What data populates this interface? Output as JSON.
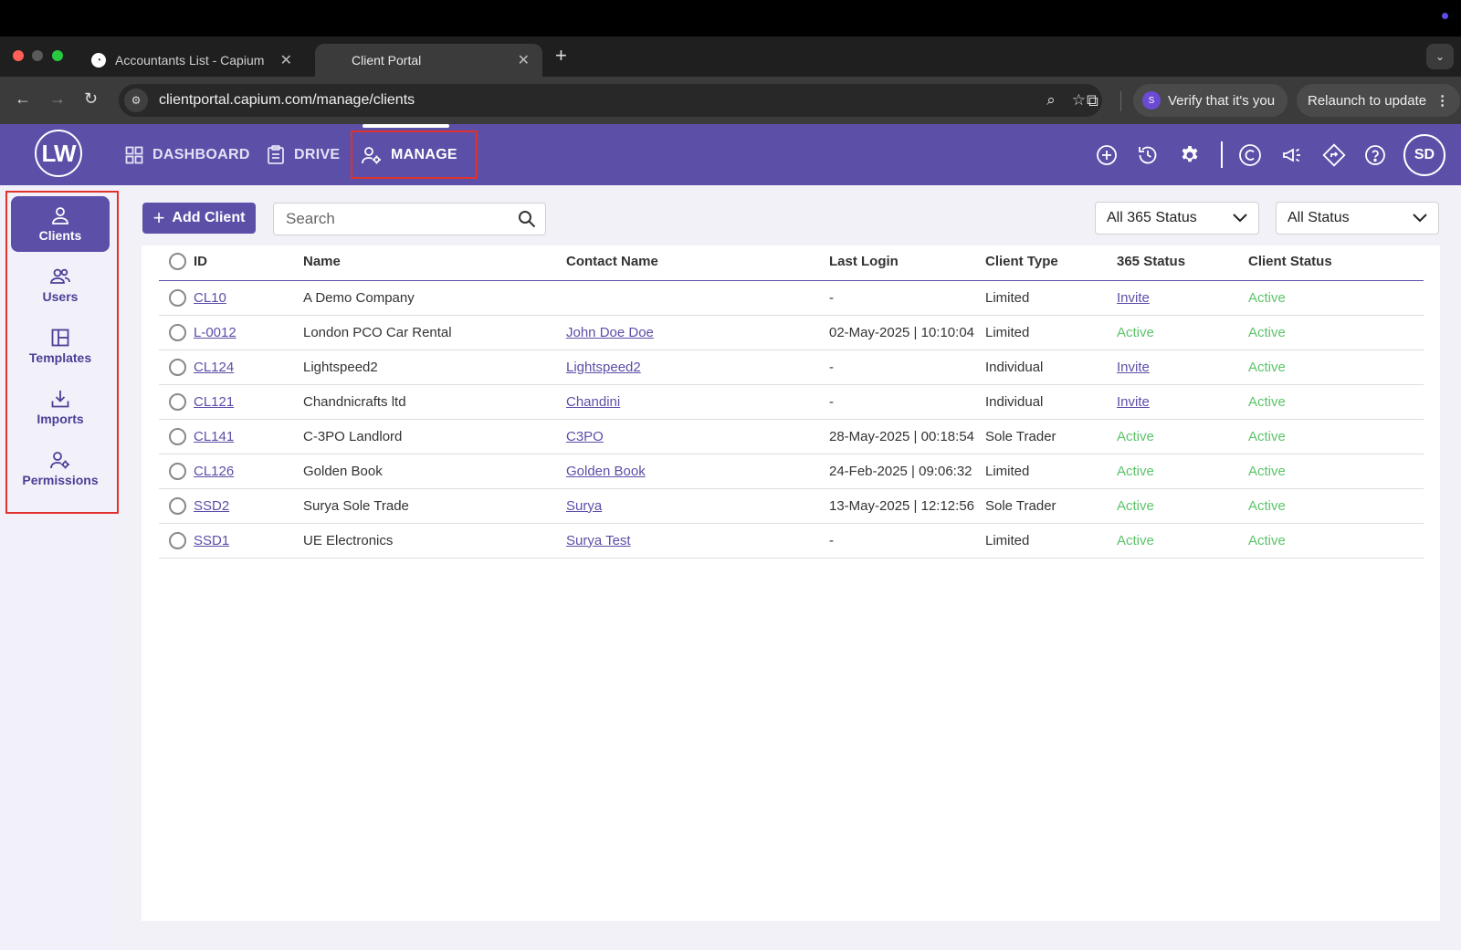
{
  "browser": {
    "tabs": [
      {
        "title": "Accountants List - Capium"
      },
      {
        "title": "Client Portal"
      }
    ],
    "url": "clientportal.capium.com/manage/clients",
    "verify_label": "Verify that it's you",
    "verify_avatar": "S",
    "relaunch_label": "Relaunch to update"
  },
  "app": {
    "logo": "LW",
    "nav": [
      {
        "label": "DASHBOARD"
      },
      {
        "label": "DRIVE"
      },
      {
        "label": "MANAGE"
      }
    ],
    "avatar": "SD"
  },
  "sidebar": {
    "items": [
      {
        "label": "Clients",
        "icon": "person-icon"
      },
      {
        "label": "Users",
        "icon": "users-icon"
      },
      {
        "label": "Templates",
        "icon": "template-icon"
      },
      {
        "label": "Imports",
        "icon": "download-icon"
      },
      {
        "label": "Permissions",
        "icon": "user-gear-icon"
      }
    ]
  },
  "toolbar": {
    "add_label": "Add Client",
    "search_placeholder": "Search",
    "filter_365": "All 365 Status",
    "filter_status": "All Status"
  },
  "table": {
    "headers": [
      "ID",
      "Name",
      "Contact Name",
      "Last Login",
      "Client Type",
      "365 Status",
      "Client Status"
    ],
    "rows": [
      {
        "id": "CL10",
        "name": "A Demo Company",
        "contact": "",
        "last_login": "-",
        "type": "Limited",
        "s365": "Invite",
        "status": "Active"
      },
      {
        "id": "L-0012",
        "name": "London PCO Car Rental",
        "contact": "John Doe Doe",
        "last_login": "02-May-2025 | 10:10:04",
        "type": "Limited",
        "s365": "Active",
        "status": "Active"
      },
      {
        "id": "CL124",
        "name": "Lightspeed2",
        "contact": "Lightspeed2",
        "last_login": "-",
        "type": "Individual",
        "s365": "Invite",
        "status": "Active"
      },
      {
        "id": "CL121",
        "name": "Chandnicrafts ltd",
        "contact": "Chandini",
        "last_login": "-",
        "type": "Individual",
        "s365": "Invite",
        "status": "Active"
      },
      {
        "id": "CL141",
        "name": "C-3PO Landlord",
        "contact": "C3PO",
        "last_login": "28-May-2025 | 00:18:54",
        "type": "Sole Trader",
        "s365": "Active",
        "status": "Active"
      },
      {
        "id": "CL126",
        "name": "Golden Book",
        "contact": "Golden Book",
        "last_login": "24-Feb-2025 | 09:06:32",
        "type": "Limited",
        "s365": "Active",
        "status": "Active"
      },
      {
        "id": "SSD2",
        "name": "Surya Sole Trade",
        "contact": "Surya",
        "last_login": "13-May-2025 | 12:12:56",
        "type": "Sole Trader",
        "s365": "Active",
        "status": "Active"
      },
      {
        "id": "SSD1",
        "name": "UE Electronics",
        "contact": "Surya Test",
        "last_login": "-",
        "type": "Limited",
        "s365": "Active",
        "status": "Active"
      }
    ]
  },
  "colors": {
    "brand": "#5b4fa8",
    "active_status": "#5cc46a",
    "highlight": "#e0322c"
  }
}
